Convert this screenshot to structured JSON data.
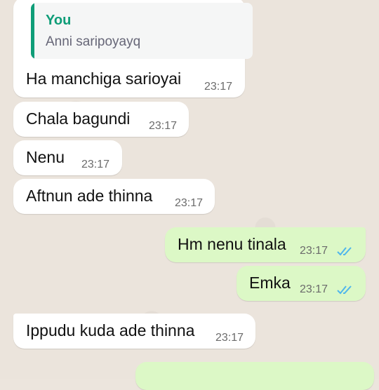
{
  "colors": {
    "incoming_bubble": "#ffffff",
    "outgoing_bubble": "#dcf8c6",
    "quote_accent": "#0f9d78",
    "read_ticks": "#4fb6ec",
    "chat_background": "#ebe4dc"
  },
  "messages": [
    {
      "direction": "incoming",
      "quote": {
        "author": "You",
        "text": "Anni saripoyayq"
      },
      "text": "Ha manchiga sarioyai",
      "time": "23:17"
    },
    {
      "direction": "incoming",
      "text": "Chala bagundi",
      "time": "23:17"
    },
    {
      "direction": "incoming",
      "text": "Nenu",
      "time": "23:17"
    },
    {
      "direction": "incoming",
      "text": "Aftnun ade thinna",
      "time": "23:17"
    },
    {
      "direction": "outgoing",
      "text": "Hm nenu tinala",
      "time": "23:17",
      "status": "read-double-check-icon"
    },
    {
      "direction": "outgoing",
      "text": "Emka",
      "time": "23:17",
      "status": "read-double-check-icon"
    },
    {
      "direction": "incoming",
      "text": "Ippudu kuda ade thinna",
      "time": "23:17"
    }
  ]
}
